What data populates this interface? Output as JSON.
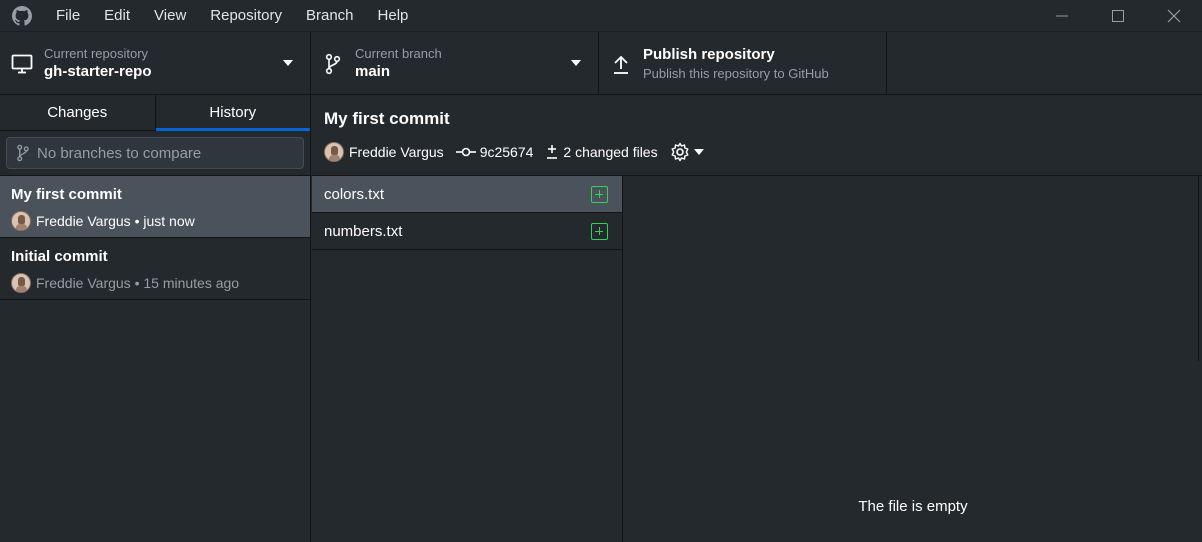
{
  "menu": {
    "items": [
      "File",
      "Edit",
      "View",
      "Repository",
      "Branch",
      "Help"
    ]
  },
  "toolbar": {
    "repo_label": "Current repository",
    "repo_value": "gh-starter-repo",
    "branch_label": "Current branch",
    "branch_value": "main",
    "publish_title": "Publish repository",
    "publish_subtitle": "Publish this repository to GitHub"
  },
  "sidebar": {
    "tabs": [
      "Changes",
      "History"
    ],
    "active_tab": "History",
    "compare_placeholder": "No branches to compare",
    "commits": [
      {
        "title": "My first commit",
        "author": "Freddie Vargus",
        "time": "just now",
        "meta": "Freddie Vargus • just now"
      },
      {
        "title": "Initial commit",
        "author": "Freddie Vargus",
        "time": "15 minutes ago",
        "meta": "Freddie Vargus • 15 minutes ago"
      }
    ]
  },
  "commit": {
    "title": "My first commit",
    "author": "Freddie Vargus",
    "sha": "9c25674",
    "changed_files": "2 changed files"
  },
  "files": [
    {
      "name": "colors.txt",
      "status": "added"
    },
    {
      "name": "numbers.txt",
      "status": "added"
    }
  ],
  "diff": {
    "message": "The file is empty"
  },
  "colors": {
    "background": "#24292e",
    "selected": "#4a525c",
    "accent": "#0366d6",
    "added": "#34d058"
  }
}
